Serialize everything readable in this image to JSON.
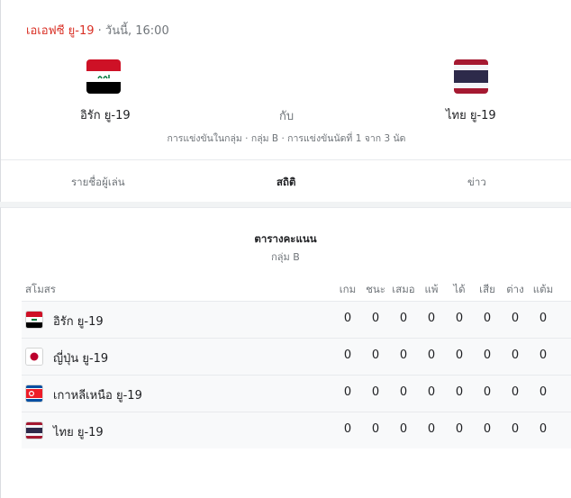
{
  "header": {
    "league": "เอเอฟซี ยู-19",
    "sep": " · ",
    "when": "วันนี้, 16:00"
  },
  "match": {
    "home": {
      "name": "อิรัก ยู-19",
      "flag_icon": "iraq-flag-icon"
    },
    "away": {
      "name": "ไทย ยู-19",
      "flag_icon": "thailand-flag-icon"
    },
    "vs": "กับ",
    "round": "การแข่งขันในกลุ่ม · กลุ่ม B · การแข่งขันนัดที่ 1 จาก 3 นัด"
  },
  "tabs": [
    {
      "label": "รายชื่อผู้เล่น",
      "active": false
    },
    {
      "label": "สถิติ",
      "active": true
    },
    {
      "label": "ข่าว",
      "active": false
    }
  ],
  "standings": {
    "title": "ตารางคะแนน",
    "group": "กลุ่ม B",
    "club_header": "สโมสร",
    "columns": [
      "เกม",
      "ชนะ",
      "เสมอ",
      "แพ้",
      "ได้",
      "เสีย",
      "ต่าง",
      "แต้ม"
    ],
    "rows": [
      {
        "name": "อิรัก ยู-19",
        "flag_icon": "iraq-flag-icon",
        "stats": [
          "0",
          "0",
          "0",
          "0",
          "0",
          "0",
          "0",
          "0"
        ]
      },
      {
        "name": "ญี่ปุ่น ยู-19",
        "flag_icon": "japan-flag-icon",
        "stats": [
          "0",
          "0",
          "0",
          "0",
          "0",
          "0",
          "0",
          "0"
        ]
      },
      {
        "name": "เกาหลีเหนือ ยู-19",
        "flag_icon": "north-korea-flag-icon",
        "stats": [
          "0",
          "0",
          "0",
          "0",
          "0",
          "0",
          "0",
          "0"
        ]
      },
      {
        "name": "ไทย ยู-19",
        "flag_icon": "thailand-flag-icon",
        "stats": [
          "0",
          "0",
          "0",
          "0",
          "0",
          "0",
          "0",
          "0"
        ]
      }
    ]
  },
  "colors": {
    "league": "#d93025",
    "muted": "#70757a",
    "row_bg": "#f8f9fa"
  }
}
